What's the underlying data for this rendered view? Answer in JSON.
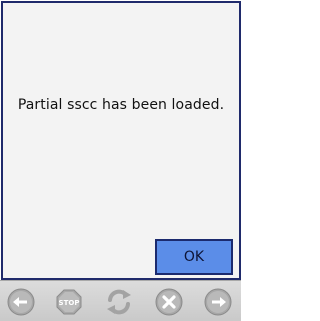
{
  "dialog": {
    "message": "Partial sscc has been loaded.",
    "ok_label": "OK"
  },
  "toolbar": {
    "stop_label": "STOP",
    "buttons": [
      {
        "icon": "back-arrow-icon"
      },
      {
        "icon": "stop-icon"
      },
      {
        "icon": "refresh-icon"
      },
      {
        "icon": "cancel-icon"
      },
      {
        "icon": "forward-arrow-icon"
      }
    ]
  },
  "colors": {
    "dialog_border": "#1f2a6b",
    "ok_button_bg": "#5b8de8",
    "toolbar_icon_gray": "#9a9a9a"
  }
}
